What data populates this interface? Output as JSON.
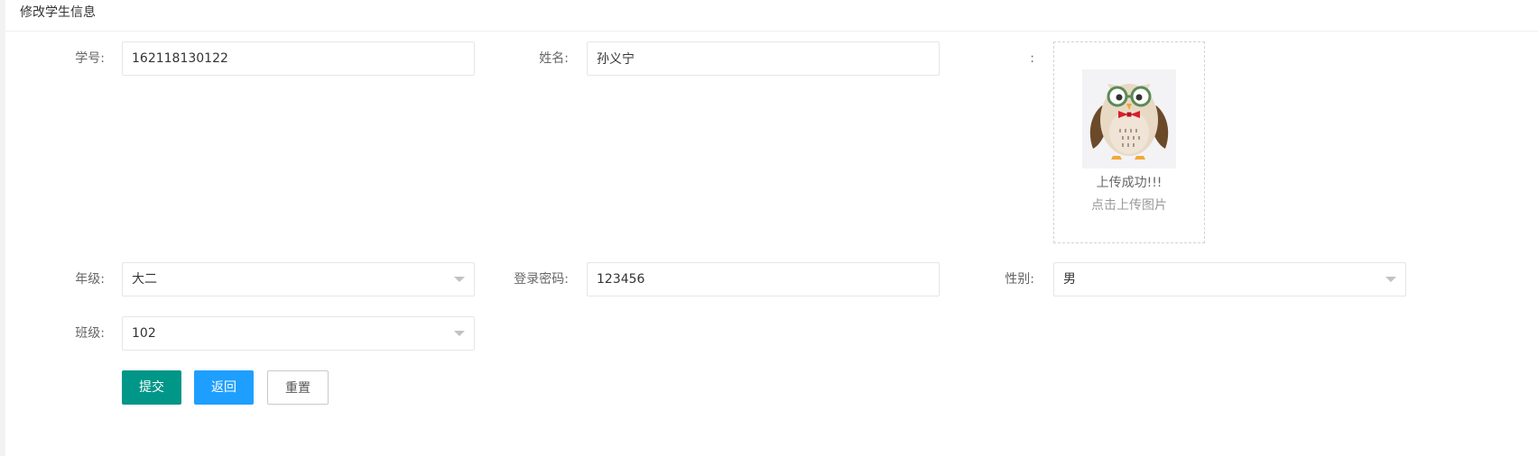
{
  "page": {
    "title": "修改学生信息"
  },
  "form": {
    "student_id": {
      "label": "学号:",
      "value": "162118130122"
    },
    "name": {
      "label": "姓名:",
      "value": "孙义宁"
    },
    "photo": {
      "label": ":",
      "status": "上传成功!!!",
      "hint": "点击上传图片"
    },
    "grade": {
      "label": "年级:",
      "value": "大二"
    },
    "password": {
      "label": "登录密码:",
      "value": "123456"
    },
    "gender": {
      "label": "性别:",
      "value": "男"
    },
    "class": {
      "label": "班级:",
      "value": "102"
    }
  },
  "buttons": {
    "submit": "提交",
    "back": "返回",
    "reset": "重置"
  },
  "colors": {
    "submit": "#009688",
    "back": "#1e9fff"
  },
  "icons": {
    "photo": "owl-avatar",
    "select_arrow": "caret-down-icon"
  }
}
